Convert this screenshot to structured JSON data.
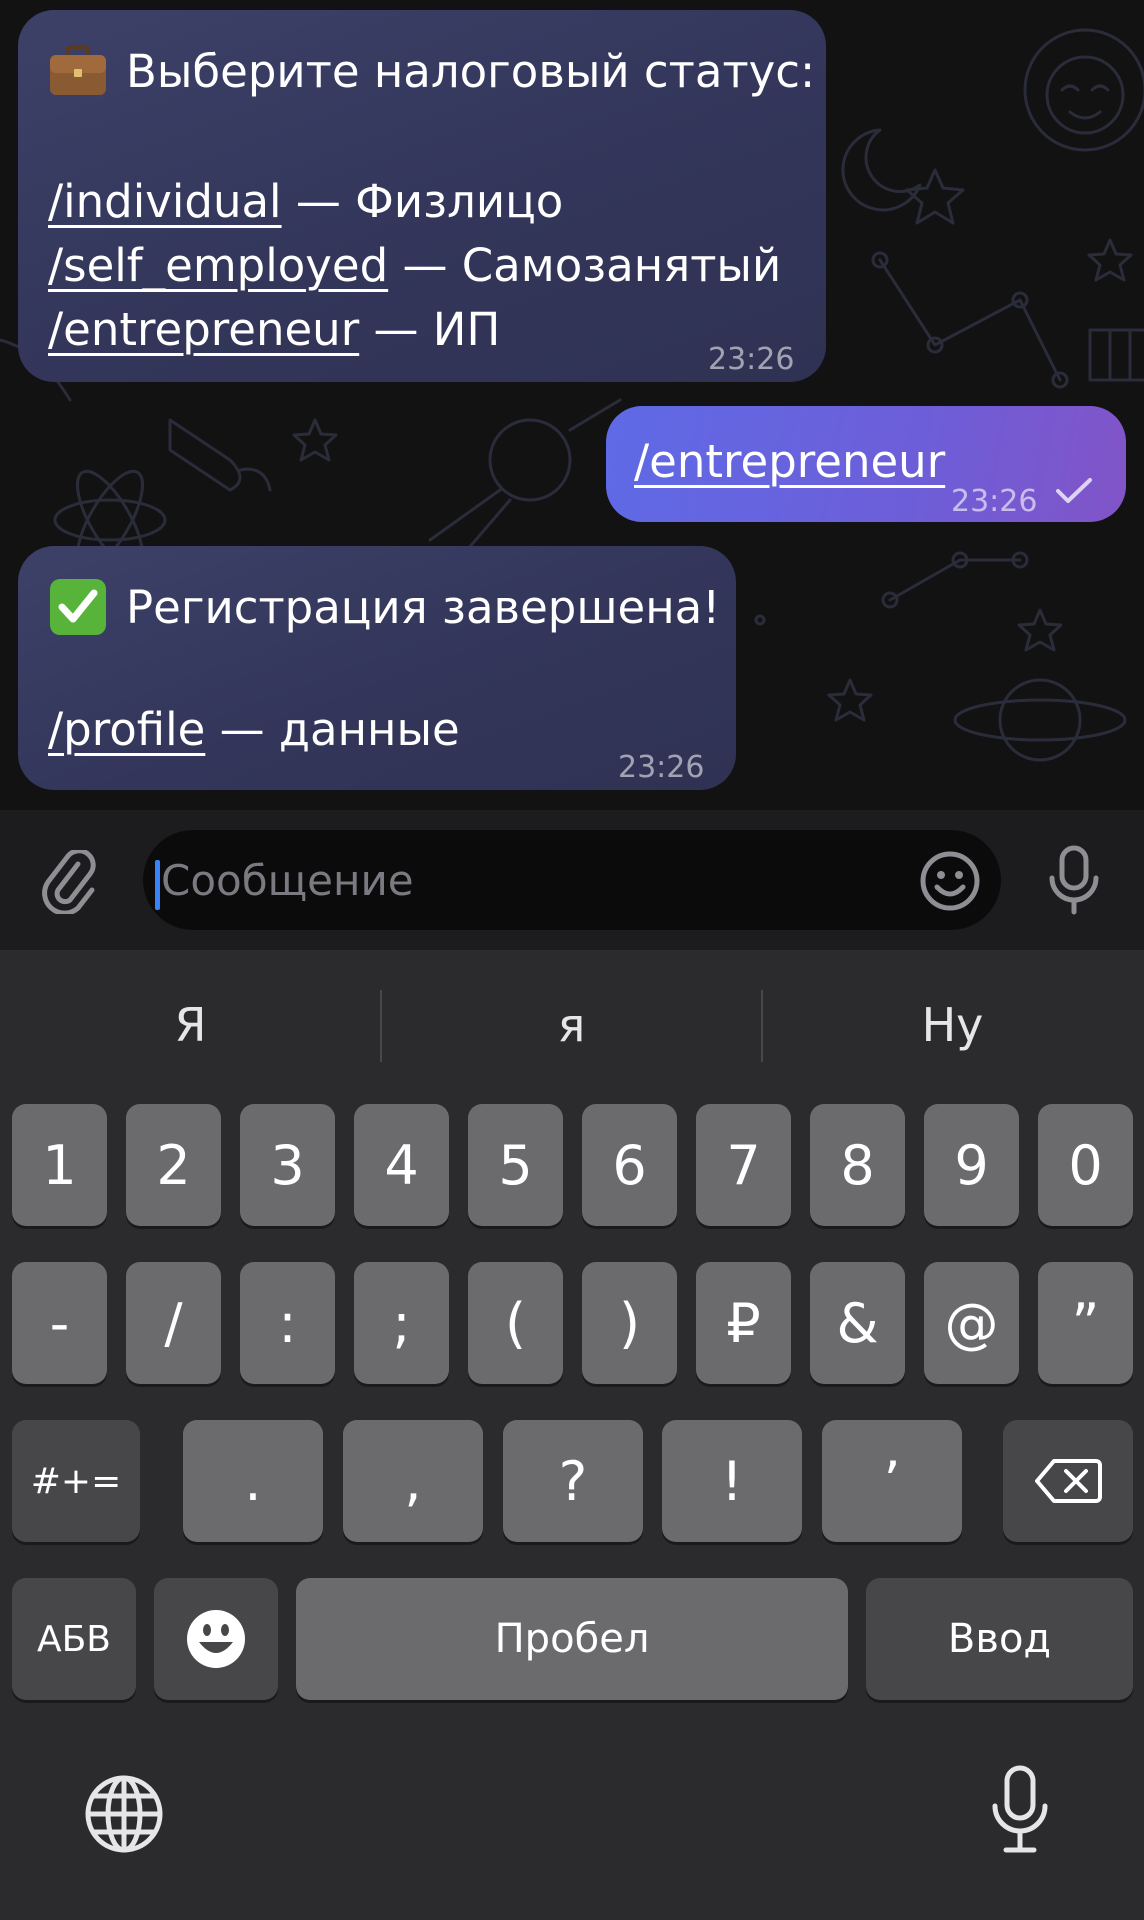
{
  "messages": [
    {
      "emoji": "briefcase",
      "heading": "Выберите налоговый статус:",
      "options": [
        {
          "command": "/individual",
          "text": " — Физлицо"
        },
        {
          "command": "/self_employed",
          "text": " — Самозанятый"
        },
        {
          "command": "/entrepreneur",
          "text": " — ИП"
        }
      ],
      "time": "23:26"
    },
    {
      "command": "/entrepreneur",
      "time": "23:26",
      "status": "✓"
    },
    {
      "emoji": "check-mark",
      "heading": "Регистрация завершена!",
      "options": [
        {
          "command": "/profile",
          "text": " — данные"
        }
      ],
      "time": "23:26"
    }
  ],
  "composer": {
    "placeholder": "Сообщение"
  },
  "keyboard": {
    "suggestions": [
      "Я",
      "я",
      "Ну"
    ],
    "row1": [
      "1",
      "2",
      "3",
      "4",
      "5",
      "6",
      "7",
      "8",
      "9",
      "0"
    ],
    "row2": [
      "-",
      "/",
      ":",
      ";",
      "(",
      ")",
      "₽",
      "&",
      "@",
      "”"
    ],
    "row3": [
      ".",
      ",",
      "?",
      "!",
      "’"
    ],
    "symbols_key": "#+=",
    "letters_key": "АБВ",
    "space_key": "Пробел",
    "return_key": "Ввод"
  },
  "colors": {
    "incoming_bubble": "#383b62",
    "outgoing_bubble": "#6d5ed8",
    "caret": "#3a82f7",
    "key": "#6b6b6e",
    "key_function": "#47474a"
  }
}
